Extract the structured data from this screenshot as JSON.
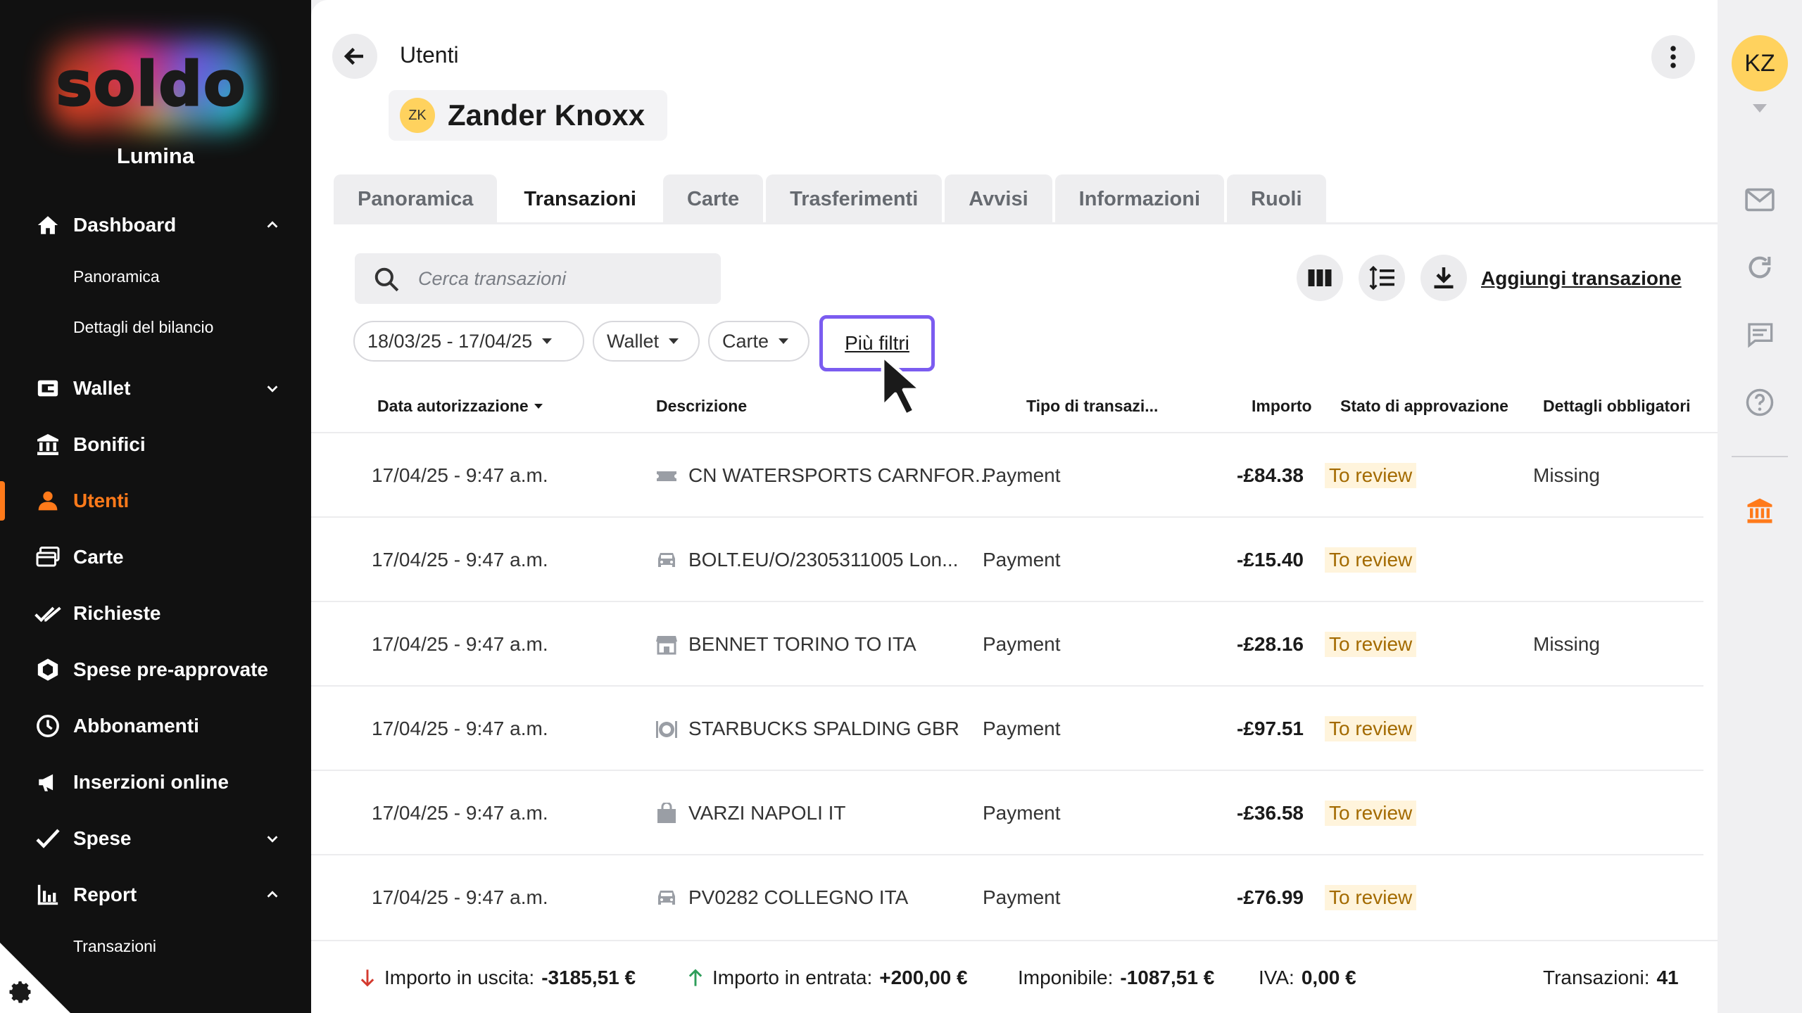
{
  "app": {
    "brand": "soldo",
    "org_name": "Lumina"
  },
  "sidebar": {
    "items": [
      {
        "label": "Dashboard",
        "icon": "home-icon",
        "expanded": true
      },
      {
        "label": "Wallet",
        "icon": "wallet-icon",
        "expanded": false
      },
      {
        "label": "Bonifici",
        "icon": "bank-transfer-icon"
      },
      {
        "label": "Utenti",
        "icon": "user-icon",
        "active": true
      },
      {
        "label": "Carte",
        "icon": "cards-icon"
      },
      {
        "label": "Richieste",
        "icon": "double-check-icon"
      },
      {
        "label": "Spese pre-approvate",
        "icon": "hexagon-icon"
      },
      {
        "label": "Abbonamenti",
        "icon": "clock-icon"
      },
      {
        "label": "Inserzioni online",
        "icon": "megaphone-icon"
      },
      {
        "label": "Spese",
        "icon": "check-icon",
        "expanded": false
      },
      {
        "label": "Report",
        "icon": "bar-chart-icon",
        "expanded": true
      }
    ],
    "dashboard_sub": [
      "Panoramica",
      "Dettagli del bilancio"
    ],
    "report_sub": [
      "Transazioni"
    ]
  },
  "header": {
    "title": "Utenti",
    "user_initials": "ZK",
    "user_name": "Zander Knoxx"
  },
  "tabs": [
    "Panoramica",
    "Transazioni",
    "Carte",
    "Trasferimenti",
    "Avvisi",
    "Informazioni",
    "Ruoli"
  ],
  "active_tab": "Transazioni",
  "toolbar": {
    "search_placeholder": "Cerca transazioni",
    "add_transaction": "Aggiungi transazione"
  },
  "filters": {
    "date_range": "18/03/25 - 17/04/25",
    "wallet": "Wallet",
    "cards": "Carte",
    "more": "Più filtri"
  },
  "table": {
    "columns": [
      "Data autorizzazione",
      "Descrizione",
      "Tipo di transazi...",
      "Importo",
      "Stato di approvazione",
      "Dettagli obbligatori"
    ],
    "rows": [
      {
        "date": "17/04/25 - 9:47 a.m.",
        "icon": "ticket-icon",
        "description": "CN WATERSPORTS CARNFOR...",
        "type": "Payment",
        "amount": "-£84.38",
        "status": "To review",
        "details": "Missing"
      },
      {
        "date": "17/04/25 - 9:47 a.m.",
        "icon": "car-icon",
        "description": "BOLT.EU/O/2305311005 Lon...",
        "type": "Payment",
        "amount": "-£15.40",
        "status": "To review",
        "details": ""
      },
      {
        "date": "17/04/25 - 9:47 a.m.",
        "icon": "store-icon",
        "description": "BENNET TORINO TO ITA",
        "type": "Payment",
        "amount": "-£28.16",
        "status": "To review",
        "details": "Missing"
      },
      {
        "date": "17/04/25 - 9:47 a.m.",
        "icon": "restaurant-icon",
        "description": "STARBUCKS SPALDING GBR",
        "type": "Payment",
        "amount": "-£97.51",
        "status": "To review",
        "details": ""
      },
      {
        "date": "17/04/25 - 9:47 a.m.",
        "icon": "shopping-bag-icon",
        "description": "VARZI NAPOLI IT",
        "type": "Payment",
        "amount": "-£36.58",
        "status": "To review",
        "details": ""
      },
      {
        "date": "17/04/25 - 9:47 a.m.",
        "icon": "car-icon",
        "description": "PV0282 COLLEGNO ITA",
        "type": "Payment",
        "amount": "-£76.99",
        "status": "To review",
        "details": ""
      }
    ]
  },
  "footer": {
    "outgoing_label": "Importo in uscita:",
    "outgoing_value": "-3185,51 €",
    "incoming_label": "Importo in entrata:",
    "incoming_value": "+200,00 €",
    "taxable_label": "Imponibile:",
    "taxable_value": "-1087,51 €",
    "vat_label": "IVA:",
    "vat_value": "0,00 €",
    "count_label": "Transazioni:",
    "count_value": "41"
  },
  "rail": {
    "avatar_initials": "KZ"
  },
  "colors": {
    "accent": "#ff7a1a",
    "focus": "#7b5cf0",
    "status_bg": "#fff4dc",
    "status_text": "#a36a00",
    "avatar": "#ffd25e"
  }
}
